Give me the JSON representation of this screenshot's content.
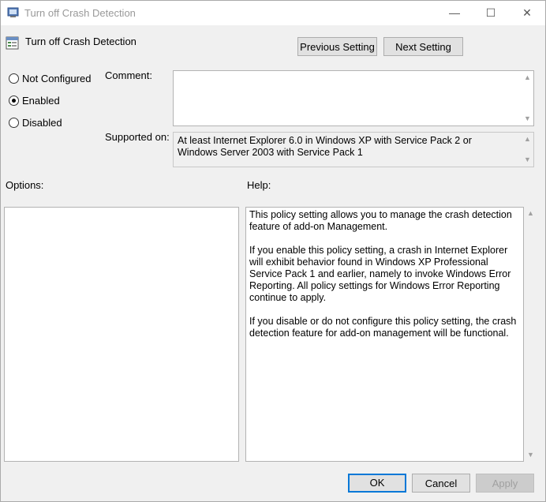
{
  "window": {
    "title": "Turn off Crash Detection",
    "minimize_glyph": "—",
    "maximize_glyph": "☐",
    "close_glyph": "✕"
  },
  "header": {
    "policy_title": "Turn off Crash Detection",
    "previous_label": "Previous Setting",
    "next_label": "Next Setting"
  },
  "state": {
    "options": [
      {
        "label": "Not Configured",
        "selected": false
      },
      {
        "label": "Enabled",
        "selected": true
      },
      {
        "label": "Disabled",
        "selected": false
      }
    ]
  },
  "comment": {
    "label": "Comment:",
    "value": ""
  },
  "supported": {
    "label": "Supported on:",
    "value": "At least Internet Explorer 6.0 in Windows XP with Service Pack 2 or Windows Server 2003 with Service Pack 1"
  },
  "options_pane": {
    "label": "Options:"
  },
  "help_pane": {
    "label": "Help:",
    "paragraphs": [
      "This policy setting allows you to manage the crash detection feature of add-on Management.",
      "If you enable this policy setting, a crash in Internet Explorer will exhibit behavior found in Windows XP Professional Service Pack 1 and earlier, namely to invoke Windows Error Reporting. All policy settings for Windows Error Reporting continue to apply.",
      "If you disable or do not configure this policy setting, the crash detection feature for add-on management will be functional."
    ]
  },
  "footer": {
    "ok_label": "OK",
    "cancel_label": "Cancel",
    "apply_label": "Apply"
  },
  "colors": {
    "accent": "#0078d7",
    "dialog_bg": "#f0f0f0"
  }
}
